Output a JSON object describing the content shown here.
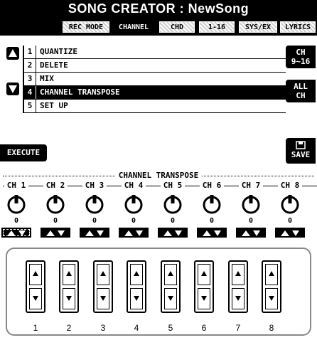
{
  "screen": {
    "title": "SONG CREATOR : NewSong",
    "tabs": [
      {
        "label": "REC MODE",
        "active": false
      },
      {
        "label": "CHANNEL",
        "active": true
      },
      {
        "label": "CHD",
        "active": false
      },
      {
        "label": "1-16",
        "active": false
      },
      {
        "label": "SYS/EX",
        "active": false
      },
      {
        "label": "LYRICS",
        "active": false
      }
    ]
  },
  "menu": {
    "items": [
      {
        "num": "1",
        "label": "QUANTIZE"
      },
      {
        "num": "2",
        "label": "DELETE"
      },
      {
        "num": "3",
        "label": "MIX"
      },
      {
        "num": "4",
        "label": "CHANNEL TRANSPOSE"
      },
      {
        "num": "5",
        "label": "SET UP"
      }
    ],
    "selected_index": 3
  },
  "buttons": {
    "ch_range": "CH\n9~16",
    "all_ch": "ALL\nCH",
    "execute": "EXECUTE",
    "save": "SAVE"
  },
  "transpose": {
    "section_title": "CHANNEL TRANSPOSE",
    "channels": [
      {
        "label": "CH 1",
        "value": "0"
      },
      {
        "label": "CH 2",
        "value": "0"
      },
      {
        "label": "CH 3",
        "value": "0"
      },
      {
        "label": "CH 4",
        "value": "0"
      },
      {
        "label": "CH 5",
        "value": "0"
      },
      {
        "label": "CH 6",
        "value": "0"
      },
      {
        "label": "CH 7",
        "value": "0"
      },
      {
        "label": "CH 8",
        "value": "0"
      }
    ]
  },
  "panel": {
    "button_numbers": [
      "1",
      "2",
      "3",
      "4",
      "5",
      "6",
      "7",
      "8"
    ]
  },
  "colors": {
    "lcd_bg": "#ffffff",
    "lcd_fg": "#000000",
    "panel_border": "#888888"
  }
}
